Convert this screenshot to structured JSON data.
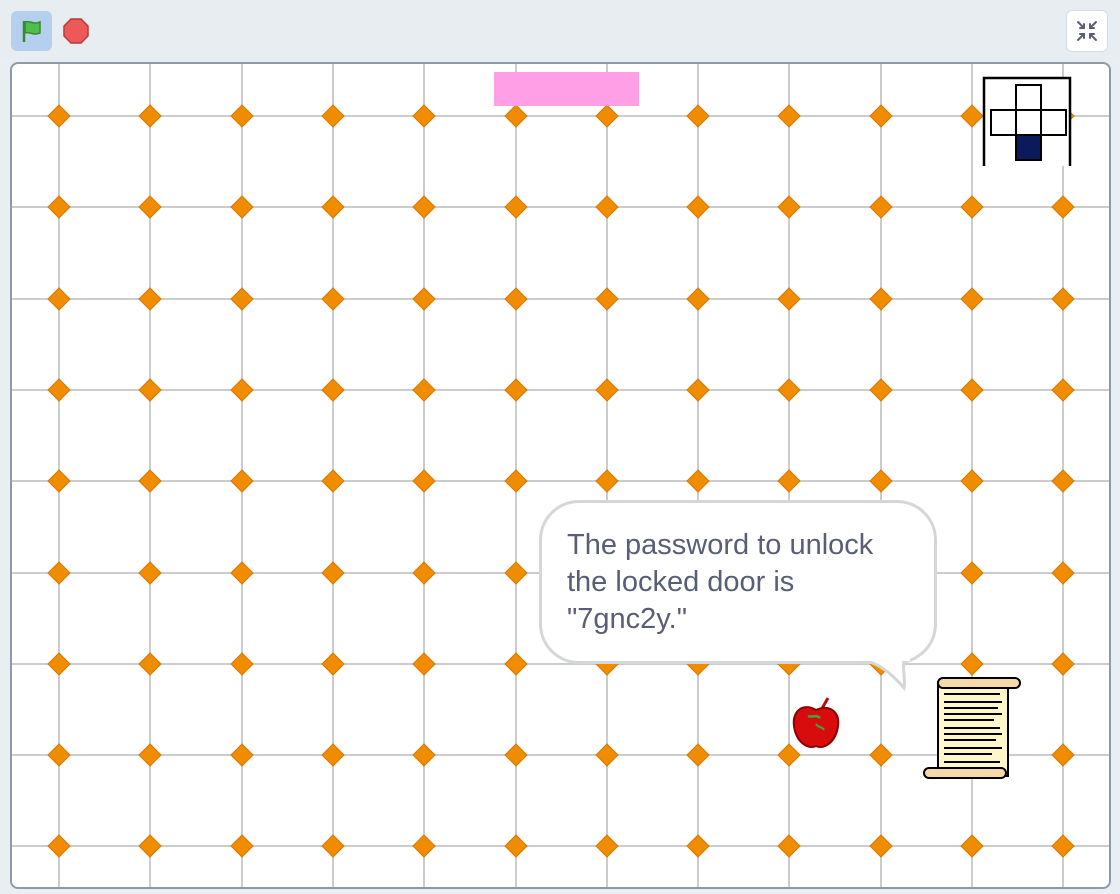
{
  "toolbar": {
    "green_flag_icon": "green-flag-icon",
    "stop_icon": "stop-sign-icon",
    "fullscreen_icon": "exit-fullscreen-icon"
  },
  "stage": {
    "speech_bubble": {
      "text": "The password to unlock the locked door is \"7gnc2y.\""
    },
    "sprites": [
      "red-apple",
      "paper-scroll"
    ],
    "minimap": "room-map"
  },
  "colors": {
    "grid_line": "#cccccc",
    "diamond": "#f08c00",
    "health_bar": "#ff9fe6",
    "minimap_current_room": "#0a1a5a",
    "flag_bg": "#b5d0ef",
    "stop": "#ec5959"
  }
}
